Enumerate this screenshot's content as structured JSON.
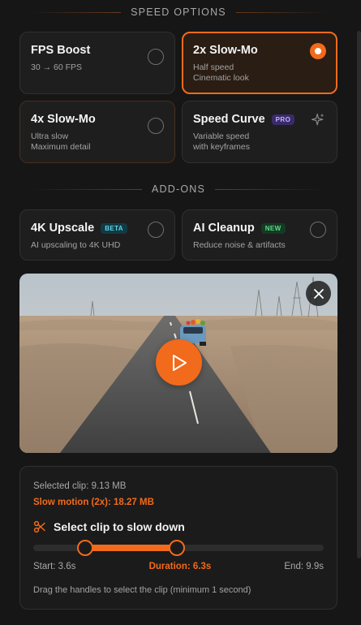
{
  "speed_options": {
    "title": "SPEED OPTIONS",
    "cards": [
      {
        "title": "FPS Boost",
        "desc": [
          "30 → 60 FPS"
        ],
        "selected": false
      },
      {
        "title": "2x Slow-Mo",
        "desc": [
          "Half speed",
          "Cinematic look"
        ],
        "selected": true
      },
      {
        "title": "4x Slow-Mo",
        "desc": [
          "Ultra slow",
          "Maximum detail"
        ],
        "selected": false
      },
      {
        "title": "Speed Curve",
        "badge": "PRO",
        "desc": [
          "Variable speed",
          "with keyframes"
        ],
        "icon": "sparkle-icon"
      }
    ]
  },
  "addons": {
    "title": "ADD-ONS",
    "cards": [
      {
        "title": "4K Upscale",
        "badge": "BETA",
        "desc": [
          "AI upscaling to 4K UHD"
        ]
      },
      {
        "title": "AI Cleanup",
        "badge": "NEW",
        "desc": [
          "Reduce noise & artifacts"
        ]
      }
    ]
  },
  "video": {
    "close_icon": "close-icon",
    "play_icon": "play-icon"
  },
  "clip": {
    "selected_size": "Selected clip: 9.13 MB",
    "slow_size": "Slow motion (2x): 18.27 MB",
    "heading": "Select clip to slow down",
    "heading_icon": "scissors-icon",
    "start_label": "Start: 3.6s",
    "duration_label": "Duration: 6.3s",
    "end_label": "End: 9.9s",
    "hint": "Drag the handles to select the clip (minimum 1 second)",
    "total_seconds": 20,
    "start_s": 3.6,
    "end_s": 9.9
  },
  "colors": {
    "accent": "#f26a1b",
    "background": "#161616",
    "card": "#1e1e1e"
  }
}
